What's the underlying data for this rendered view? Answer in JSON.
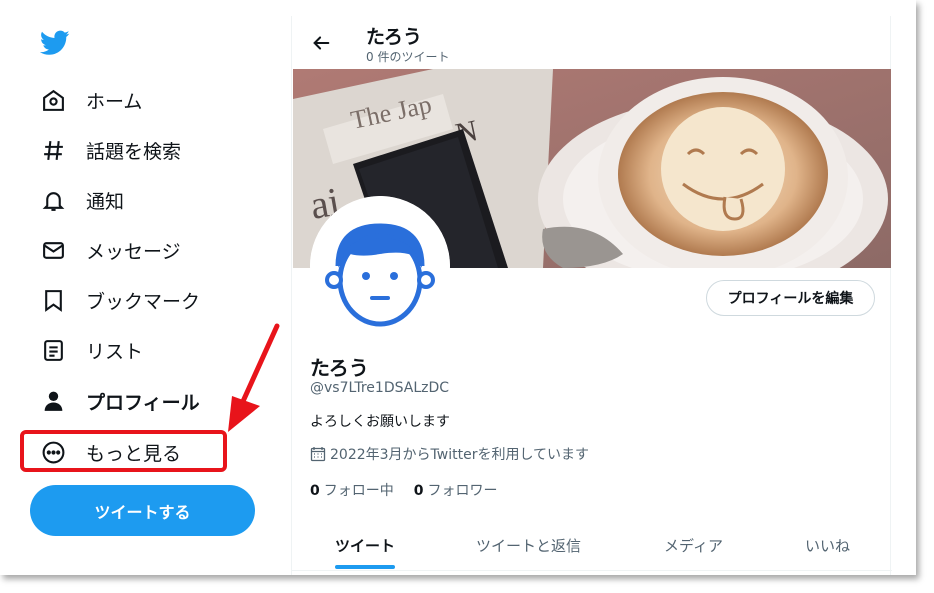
{
  "sidebar": {
    "items": [
      {
        "label": "ホーム",
        "icon": "home-icon"
      },
      {
        "label": "話題を検索",
        "icon": "hashtag-icon"
      },
      {
        "label": "通知",
        "icon": "bell-icon"
      },
      {
        "label": "メッセージ",
        "icon": "envelope-icon"
      },
      {
        "label": "ブックマーク",
        "icon": "bookmark-icon"
      },
      {
        "label": "リスト",
        "icon": "list-icon"
      },
      {
        "label": "プロフィール",
        "icon": "person-icon"
      },
      {
        "label": "もっと見る",
        "icon": "more-circle-icon"
      }
    ],
    "tweet_button": "ツイートする"
  },
  "header": {
    "title": "たろう",
    "subtitle": "0 件のツイート"
  },
  "profile": {
    "name": "たろう",
    "handle": "@vs7LTre1DSALzDC",
    "bio": "よろしくお願いします",
    "joined": "2022年3月からTwitterを利用しています",
    "following_count": "0",
    "following_label": "フォロー中",
    "followers_count": "0",
    "followers_label": "フォロワー",
    "edit_button": "プロフィールを編集"
  },
  "tabs": [
    "ツイート",
    "ツイートと返信",
    "メディア",
    "いいね"
  ],
  "colors": {
    "accent": "#1d9bf0",
    "highlight": "#e8141b",
    "avatar": "#2a6fdb"
  }
}
